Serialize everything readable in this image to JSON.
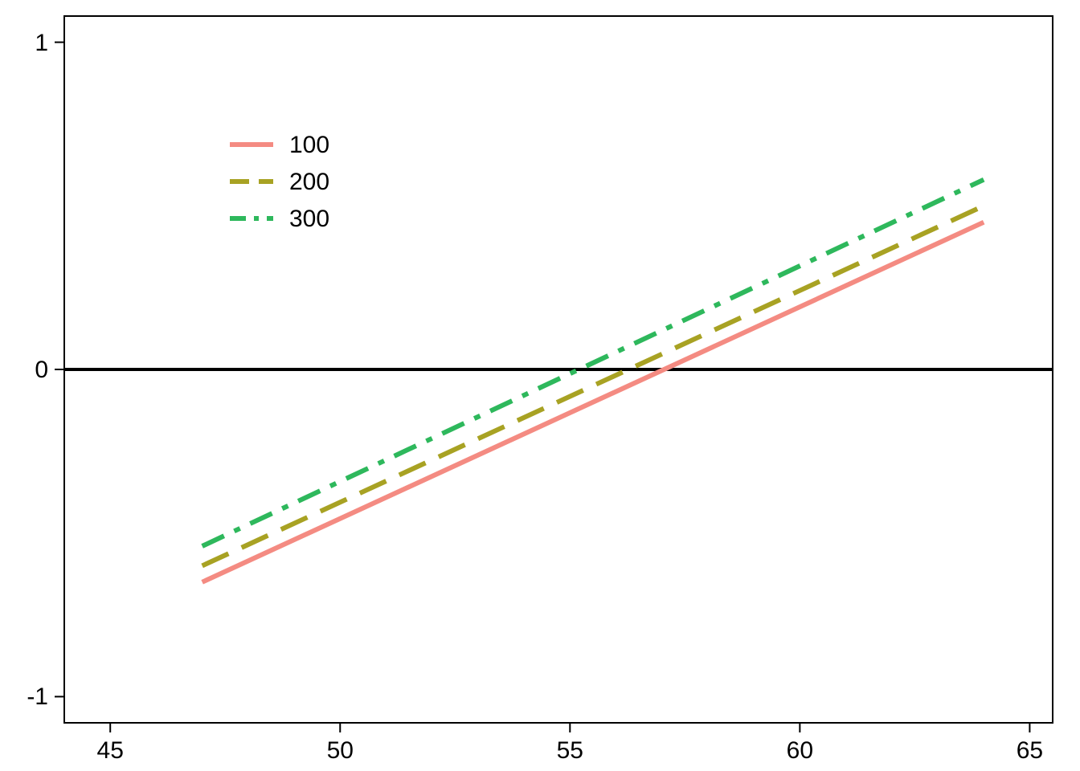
{
  "chart_data": {
    "type": "line",
    "x": [
      47,
      64
    ],
    "series": [
      {
        "name": "100",
        "values": [
          -0.65,
          0.45
        ],
        "color": "#f48b82",
        "dash": "solid"
      },
      {
        "name": "200",
        "values": [
          -0.6,
          0.5
        ],
        "color": "#a8a223",
        "dash": "dashed"
      },
      {
        "name": "300",
        "values": [
          -0.54,
          0.58
        ],
        "color": "#2eb85c",
        "dash": "dashdot"
      }
    ],
    "xlim": [
      44,
      65.5
    ],
    "ylim": [
      -1.08,
      1.08
    ],
    "x_ticks": [
      45,
      50,
      55,
      60,
      65
    ],
    "y_ticks": [
      -1,
      0,
      1
    ],
    "hline": 0,
    "title": "",
    "xlabel": "",
    "ylabel": "",
    "legend_position": "inside-top-left"
  },
  "legend": {
    "items": [
      {
        "label": "100"
      },
      {
        "label": "200"
      },
      {
        "label": "300"
      }
    ]
  },
  "ticks": {
    "x": [
      "45",
      "50",
      "55",
      "60",
      "65"
    ],
    "y": [
      "-1",
      "0",
      "1"
    ]
  }
}
